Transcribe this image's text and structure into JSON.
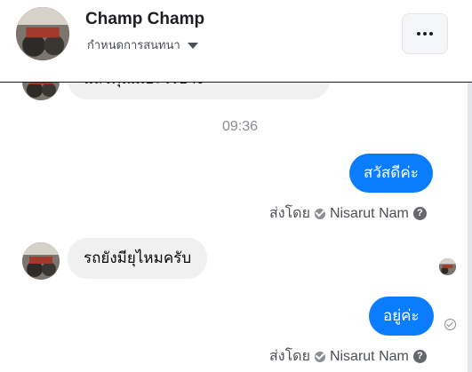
{
  "header": {
    "title": "Champ Champ",
    "subtitle": "กำหนดการสนทนา",
    "more_label": "•••"
  },
  "thread": {
    "partial_message": "แล้วคุณมีอะไรบ้าง",
    "timestamp": "09:36",
    "messages": [
      {
        "side": "out",
        "text": "สวัสดีค่ะ"
      },
      {
        "side": "in",
        "text": "รถยังมียุไหมครับ"
      },
      {
        "side": "out",
        "text": "อยู่ค่ะ"
      }
    ],
    "sent_by_prefix": "ส่งโดย",
    "sent_by_name": "Nisarut Nam",
    "help_glyph": "?"
  },
  "colors": {
    "outgoing_bubble": "#0a7cff",
    "incoming_bubble": "#f0f0f0",
    "muted_text": "#8a8d91"
  }
}
